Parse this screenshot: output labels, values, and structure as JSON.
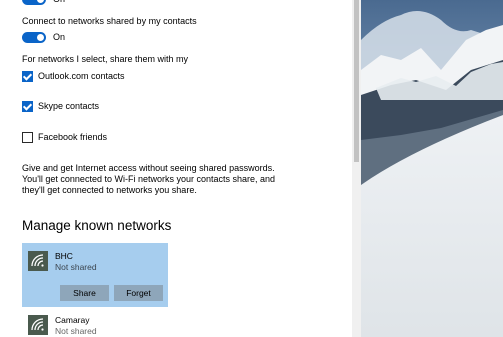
{
  "sharing": {
    "first_toggle_state": "On",
    "contacts_label": "Connect to networks shared by my contacts",
    "contacts_toggle_state": "On",
    "share_with_label": "For networks I select, share them with my",
    "options": [
      {
        "label": "Outlook.com contacts",
        "checked": true
      },
      {
        "label": "Skype contacts",
        "checked": true
      },
      {
        "label": "Facebook friends",
        "checked": false
      }
    ],
    "description_lines": [
      "Give and get Internet access without seeing shared passwords.",
      "You'll get connected to Wi-Fi networks your contacts share, and",
      "they'll get connected to networks you share."
    ]
  },
  "manage": {
    "heading": "Manage known networks",
    "networks": [
      {
        "name": "BHC",
        "status": "Not shared",
        "selected": true,
        "share_label": "Share",
        "forget_label": "Forget"
      },
      {
        "name": "Camaray",
        "status": "Not shared",
        "selected": false
      }
    ]
  },
  "colors": {
    "accent": "#0a64c8",
    "selected_row": "#a6cdee",
    "button": "#8ea6ba",
    "wifi_tile": "#4a5a4e"
  }
}
